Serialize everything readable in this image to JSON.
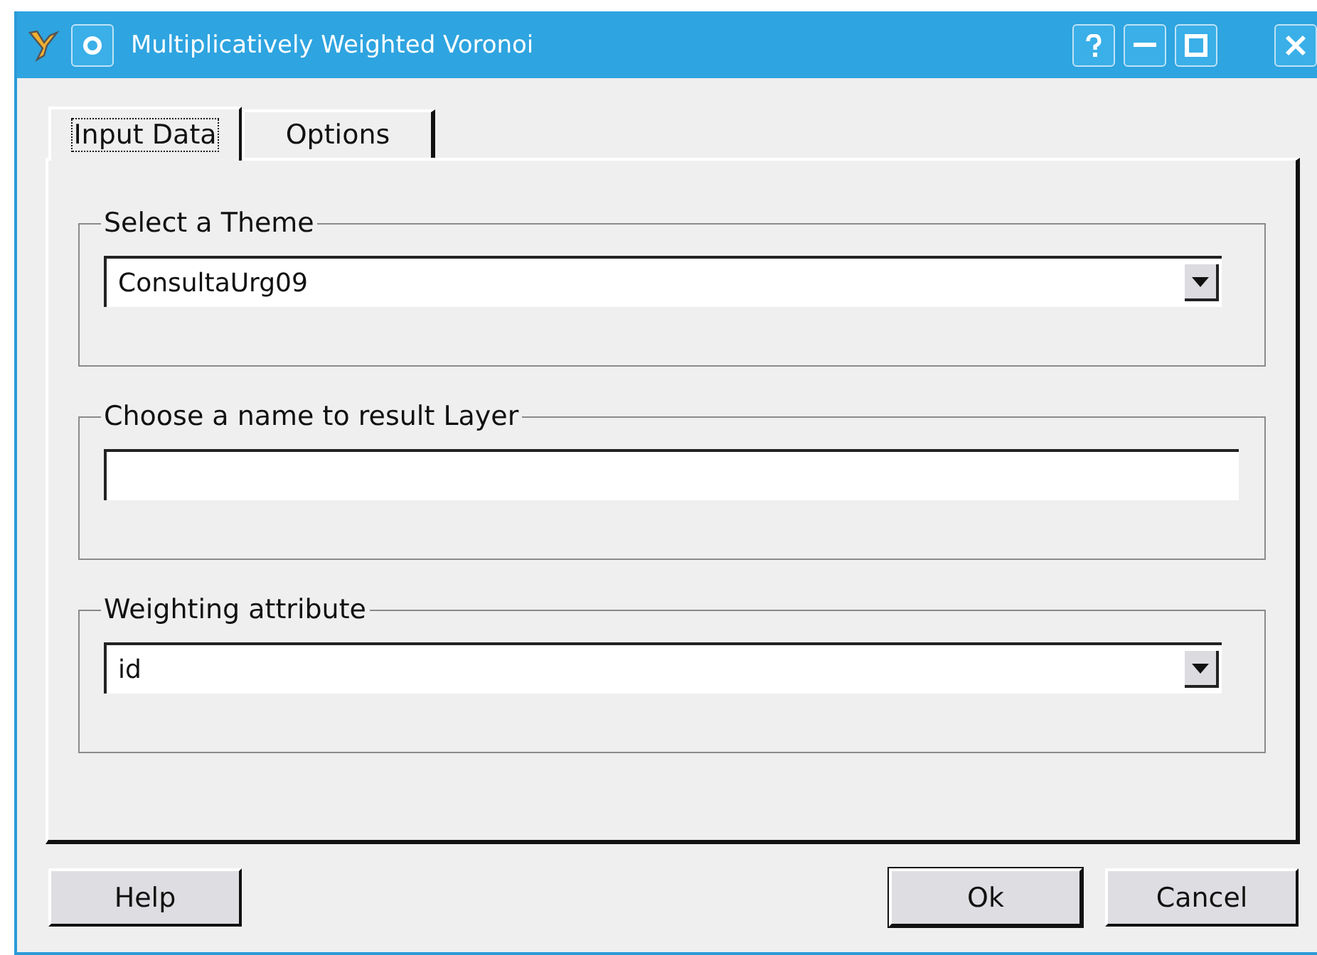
{
  "window": {
    "title": "Multiplicatively Weighted Voronoi"
  },
  "tabs": [
    {
      "label": "Input Data",
      "selected": true
    },
    {
      "label": "Options",
      "selected": false
    }
  ],
  "groups": [
    {
      "title": "Select a Theme",
      "kind": "combo",
      "value": "ConsultaUrg09"
    },
    {
      "title": "Choose a name to result Layer",
      "kind": "text"
    },
    {
      "title": "Weighting attribute",
      "kind": "combo",
      "value": "id"
    }
  ],
  "left_buttons": [
    {
      "label": "Help",
      "default": false
    }
  ],
  "right_buttons": [
    {
      "label": "Ok",
      "default": true
    },
    {
      "label": "Cancel",
      "default": false
    }
  ]
}
